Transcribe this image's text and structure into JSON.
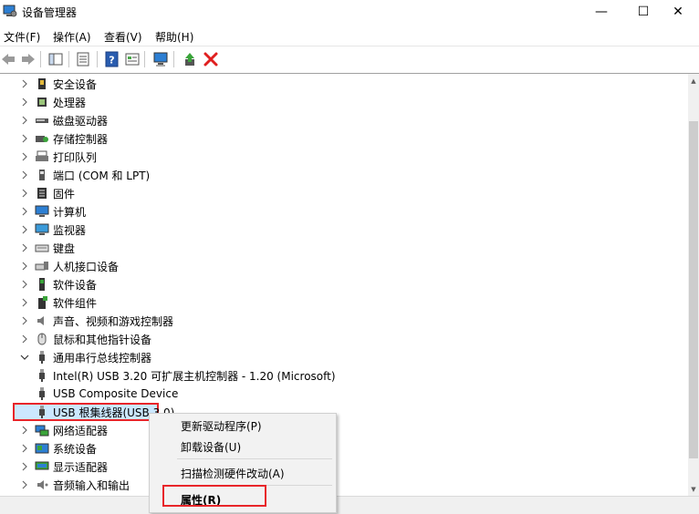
{
  "window": {
    "title": "设备管理器",
    "minimize": "—",
    "maximize": "☐",
    "close": "✕"
  },
  "menu": [
    "文件(F)",
    "操作(A)",
    "查看(V)",
    "帮助(H)"
  ],
  "tree": [
    {
      "label": "安全设备",
      "icon": "security-device-icon",
      "expanded": false
    },
    {
      "label": "处理器",
      "icon": "processor-icon",
      "expanded": false
    },
    {
      "label": "磁盘驱动器",
      "icon": "disk-drive-icon",
      "expanded": false
    },
    {
      "label": "存储控制器",
      "icon": "storage-controller-icon",
      "expanded": false
    },
    {
      "label": "打印队列",
      "icon": "printer-icon",
      "expanded": false
    },
    {
      "label": "端口 (COM 和 LPT)",
      "icon": "port-icon",
      "expanded": false
    },
    {
      "label": "固件",
      "icon": "firmware-icon",
      "expanded": false
    },
    {
      "label": "计算机",
      "icon": "computer-icon",
      "expanded": false
    },
    {
      "label": "监视器",
      "icon": "monitor-icon",
      "expanded": false
    },
    {
      "label": "键盘",
      "icon": "keyboard-icon",
      "expanded": false
    },
    {
      "label": "人机接口设备",
      "icon": "hid-icon",
      "expanded": false
    },
    {
      "label": "软件设备",
      "icon": "software-device-icon",
      "expanded": false
    },
    {
      "label": "软件组件",
      "icon": "software-component-icon",
      "expanded": false
    },
    {
      "label": "声音、视频和游戏控制器",
      "icon": "speaker-icon",
      "expanded": false
    },
    {
      "label": "鼠标和其他指针设备",
      "icon": "mouse-icon",
      "expanded": false
    },
    {
      "label": "通用串行总线控制器",
      "icon": "usb-icon",
      "expanded": true
    },
    {
      "label": "Intel(R) USB 3.20 可扩展主机控制器 - 1.20 (Microsoft)",
      "icon": "usb-icon",
      "child": true
    },
    {
      "label": "USB Composite Device",
      "icon": "usb-icon",
      "child": true
    },
    {
      "label": "USB 根集线器(USB 3.0)",
      "icon": "usb-icon",
      "child": true,
      "selected": true
    },
    {
      "label": "网络适配器",
      "icon": "network-icon",
      "expanded": false
    },
    {
      "label": "系统设备",
      "icon": "system-device-icon",
      "expanded": false
    },
    {
      "label": "显示适配器",
      "icon": "display-adapter-icon",
      "expanded": false
    },
    {
      "label": "音频输入和输出",
      "icon": "audio-io-icon",
      "expanded": false
    }
  ],
  "context_menu": {
    "update_driver": "更新驱动程序(P)",
    "uninstall": "卸载设备(U)",
    "scan": "扫描检测硬件改动(A)",
    "properties": "属性(R)"
  },
  "colors": {
    "highlight_border": "#e8252a",
    "selection_bg": "#cce8ff"
  }
}
